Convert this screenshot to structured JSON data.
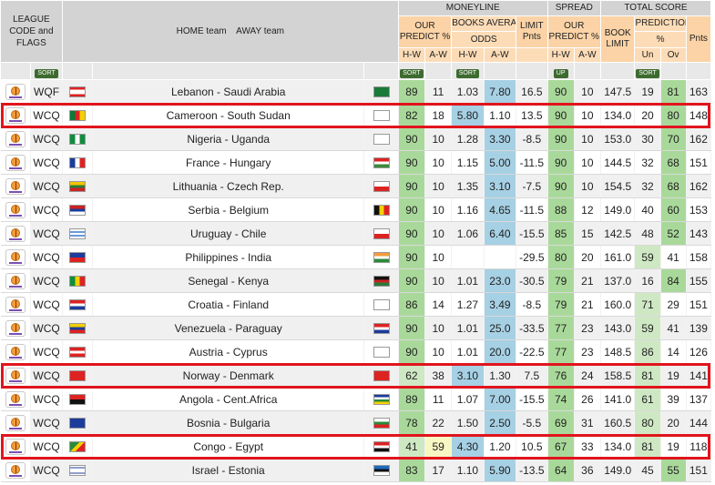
{
  "header": {
    "league_code_flags": "LEAGUE CODE and FLAGS",
    "home_away": "HOME team    AWAY team",
    "moneyline": "MONEYLINE",
    "spread": "SPREAD",
    "total_score": "TOTAL SCORE",
    "our_predict": "OUR PREDICT %",
    "books_average": "BOOKS AVERAGE",
    "odds": "ODDS",
    "limit_pnts": "LIMIT Pnts",
    "book_limit": "BOOK LIMIT",
    "prediction": "PREDICTION",
    "prediction_pct": "%",
    "pnts": "Pnts",
    "hw": "H-W",
    "aw": "A-W",
    "un": "Un",
    "ov": "Ov"
  },
  "sort": {
    "label": "SORT",
    "up": "UP"
  },
  "colors": {
    "highlight_box": "#e1141c",
    "green": "#a9d99a",
    "blue": "#a6d0e4",
    "header_orange": "#fbd3a6"
  },
  "icons": {
    "league_logo": "basketball-trophy-icon",
    "flag": "country-flag-icon"
  },
  "rows": [
    {
      "code": "WQF",
      "home": "Lebanon",
      "away": "Saudi Arabia",
      "p_hw": "89",
      "p_aw": "11",
      "o_hw": "1.03",
      "o_aw": "7.80",
      "limit": "16.5",
      "s_hw": "90",
      "s_aw": "10",
      "book_limit": "147.5",
      "un": "19",
      "ov": "81",
      "pnts": "163"
    },
    {
      "code": "WCQ",
      "home": "Cameroon",
      "away": "South Sudan",
      "p_hw": "82",
      "p_aw": "18",
      "o_hw": "5.80",
      "o_aw": "1.10",
      "limit": "13.5",
      "s_hw": "90",
      "s_aw": "10",
      "book_limit": "134.0",
      "un": "20",
      "ov": "80",
      "pnts": "148"
    },
    {
      "code": "WCQ",
      "home": "Nigeria",
      "away": "Uganda",
      "p_hw": "90",
      "p_aw": "10",
      "o_hw": "1.28",
      "o_aw": "3.30",
      "limit": "-8.5",
      "s_hw": "90",
      "s_aw": "10",
      "book_limit": "153.0",
      "un": "30",
      "ov": "70",
      "pnts": "162"
    },
    {
      "code": "WCQ",
      "home": "France",
      "away": "Hungary",
      "p_hw": "90",
      "p_aw": "10",
      "o_hw": "1.15",
      "o_aw": "5.00",
      "limit": "-11.5",
      "s_hw": "90",
      "s_aw": "10",
      "book_limit": "144.5",
      "un": "32",
      "ov": "68",
      "pnts": "151"
    },
    {
      "code": "WCQ",
      "home": "Lithuania",
      "away": "Czech Rep.",
      "p_hw": "90",
      "p_aw": "10",
      "o_hw": "1.35",
      "o_aw": "3.10",
      "limit": "-7.5",
      "s_hw": "90",
      "s_aw": "10",
      "book_limit": "154.5",
      "un": "32",
      "ov": "68",
      "pnts": "162"
    },
    {
      "code": "WCQ",
      "home": "Serbia",
      "away": "Belgium",
      "p_hw": "90",
      "p_aw": "10",
      "o_hw": "1.16",
      "o_aw": "4.65",
      "limit": "-11.5",
      "s_hw": "88",
      "s_aw": "12",
      "book_limit": "149.0",
      "un": "40",
      "ov": "60",
      "pnts": "153"
    },
    {
      "code": "WCQ",
      "home": "Uruguay",
      "away": "Chile",
      "p_hw": "90",
      "p_aw": "10",
      "o_hw": "1.06",
      "o_aw": "6.40",
      "limit": "-15.5",
      "s_hw": "85",
      "s_aw": "15",
      "book_limit": "142.5",
      "un": "48",
      "ov": "52",
      "pnts": "143"
    },
    {
      "code": "WCQ",
      "home": "Philippines",
      "away": "India",
      "p_hw": "90",
      "p_aw": "10",
      "o_hw": "",
      "o_aw": "",
      "limit": "-29.5",
      "s_hw": "80",
      "s_aw": "20",
      "book_limit": "161.0",
      "un": "59",
      "ov": "41",
      "pnts": "158"
    },
    {
      "code": "WCQ",
      "home": "Senegal",
      "away": "Kenya",
      "p_hw": "90",
      "p_aw": "10",
      "o_hw": "1.01",
      "o_aw": "23.0",
      "limit": "-30.5",
      "s_hw": "79",
      "s_aw": "21",
      "book_limit": "137.0",
      "un": "16",
      "ov": "84",
      "pnts": "155"
    },
    {
      "code": "WCQ",
      "home": "Croatia",
      "away": "Finland",
      "p_hw": "86",
      "p_aw": "14",
      "o_hw": "1.27",
      "o_aw": "3.49",
      "limit": "-8.5",
      "s_hw": "79",
      "s_aw": "21",
      "book_limit": "160.0",
      "un": "71",
      "ov": "29",
      "pnts": "151"
    },
    {
      "code": "WCQ",
      "home": "Venezuela",
      "away": "Paraguay",
      "p_hw": "90",
      "p_aw": "10",
      "o_hw": "1.01",
      "o_aw": "25.0",
      "limit": "-33.5",
      "s_hw": "77",
      "s_aw": "23",
      "book_limit": "143.0",
      "un": "59",
      "ov": "41",
      "pnts": "139"
    },
    {
      "code": "WCQ",
      "home": "Austria",
      "away": "Cyprus",
      "p_hw": "90",
      "p_aw": "10",
      "o_hw": "1.01",
      "o_aw": "20.0",
      "limit": "-22.5",
      "s_hw": "77",
      "s_aw": "23",
      "book_limit": "148.5",
      "un": "86",
      "ov": "14",
      "pnts": "126"
    },
    {
      "code": "WCQ",
      "home": "Norway",
      "away": "Denmark",
      "p_hw": "62",
      "p_aw": "38",
      "o_hw": "3.10",
      "o_aw": "1.30",
      "limit": "7.5",
      "s_hw": "76",
      "s_aw": "24",
      "book_limit": "158.5",
      "un": "81",
      "ov": "19",
      "pnts": "141"
    },
    {
      "code": "WCQ",
      "home": "Angola",
      "away": "Cent.Africa",
      "p_hw": "89",
      "p_aw": "11",
      "o_hw": "1.07",
      "o_aw": "7.00",
      "limit": "-15.5",
      "s_hw": "74",
      "s_aw": "26",
      "book_limit": "141.0",
      "un": "61",
      "ov": "39",
      "pnts": "137"
    },
    {
      "code": "WCQ",
      "home": "Bosnia",
      "away": "Bulgaria",
      "p_hw": "78",
      "p_aw": "22",
      "o_hw": "1.50",
      "o_aw": "2.50",
      "limit": "-5.5",
      "s_hw": "69",
      "s_aw": "31",
      "book_limit": "160.5",
      "un": "80",
      "ov": "20",
      "pnts": "144"
    },
    {
      "code": "WCQ",
      "home": "Congo",
      "away": "Egypt",
      "p_hw": "41",
      "p_aw": "59",
      "o_hw": "4.30",
      "o_aw": "1.20",
      "limit": "10.5",
      "s_hw": "67",
      "s_aw": "33",
      "book_limit": "134.0",
      "un": "81",
      "ov": "19",
      "pnts": "118"
    },
    {
      "code": "WCQ",
      "home": "Israel",
      "away": "Estonia",
      "p_hw": "83",
      "p_aw": "17",
      "o_hw": "1.10",
      "o_aw": "5.90",
      "limit": "-13.5",
      "s_hw": "64",
      "s_aw": "36",
      "book_limit": "149.0",
      "un": "45",
      "ov": "55",
      "pnts": "151"
    }
  ]
}
